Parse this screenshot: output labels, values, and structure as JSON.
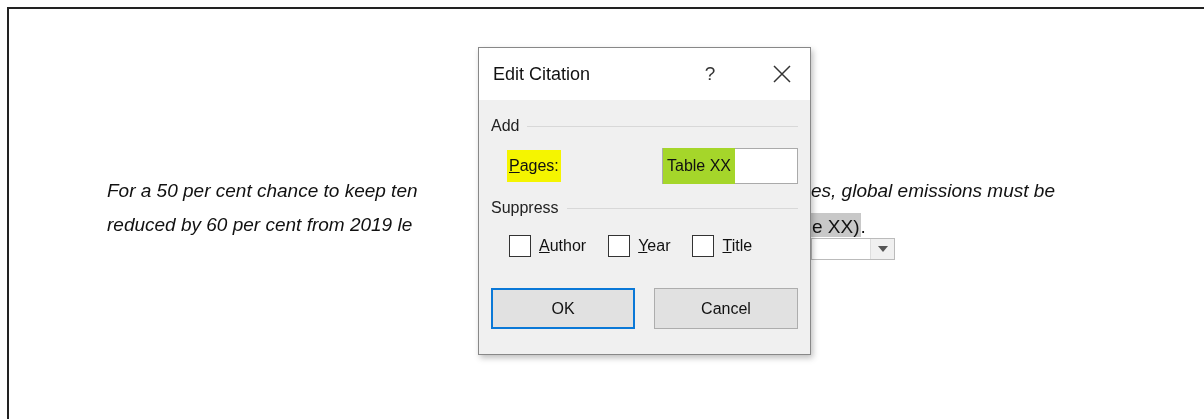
{
  "document": {
    "lines": [
      {
        "left": "For a 50 per cent chance to keep ten",
        "right": "es, global emissions must be"
      },
      {
        "left": "reduced by 60 per cent from 2019 le",
        "citation": "e XX)",
        "after": "."
      }
    ]
  },
  "dialog": {
    "title": "Edit Citation",
    "help": "?",
    "add": {
      "heading": "Add",
      "pages": {
        "access_key": "P",
        "label_rest": "ages:",
        "highlighted": true,
        "value": "Table XX",
        "value_selected": true
      }
    },
    "suppress": {
      "heading": "Suppress",
      "options": [
        {
          "access_key": "A",
          "label_rest": "uthor",
          "checked": false
        },
        {
          "access_key": "Y",
          "label_rest": "ear",
          "checked": false
        },
        {
          "access_key": "T",
          "label_rest": "itle",
          "checked": false
        }
      ]
    },
    "buttons": [
      {
        "label": "OK",
        "default": true
      },
      {
        "label": "Cancel",
        "default": false
      }
    ]
  }
}
